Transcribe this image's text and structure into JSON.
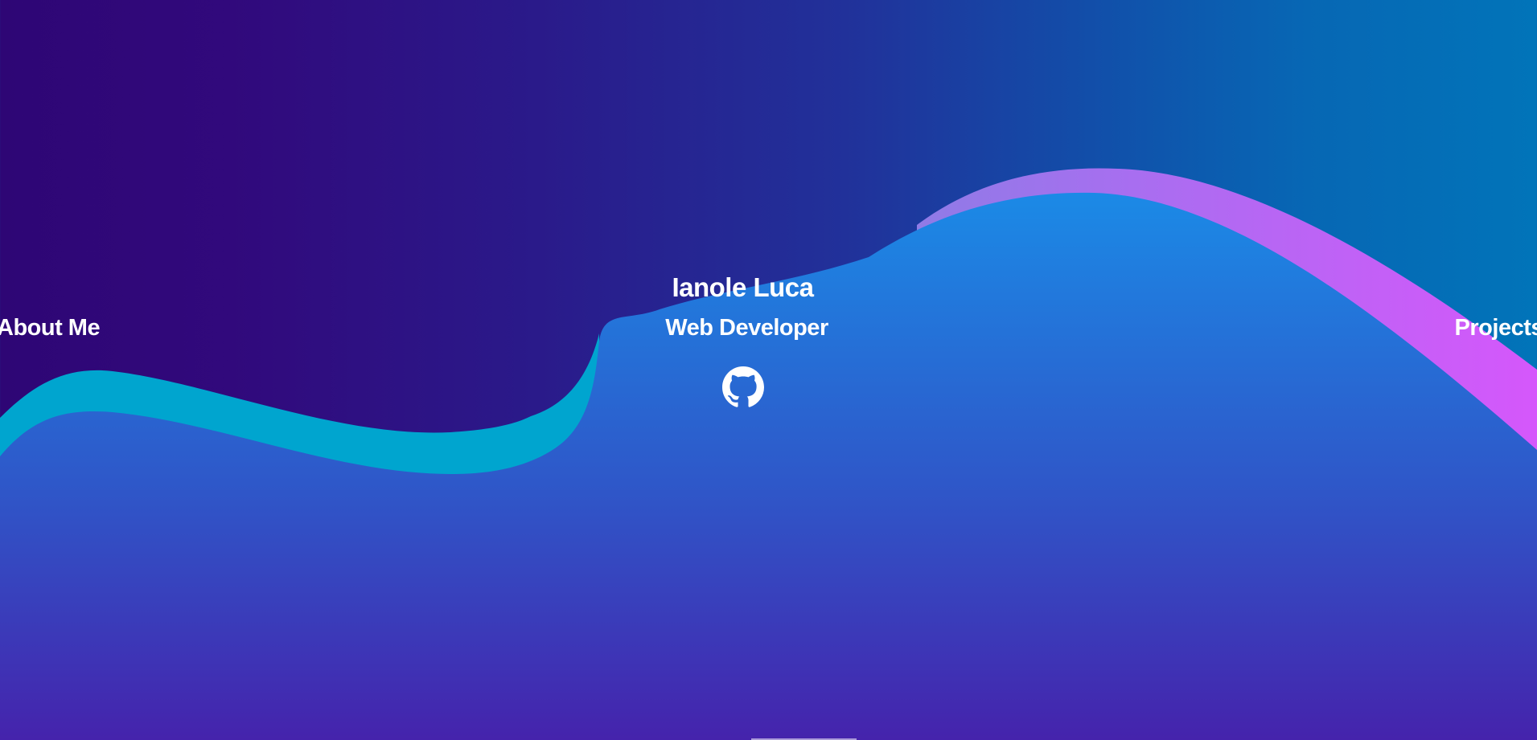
{
  "nav": {
    "left_label": "About Me",
    "right_label": "Projects"
  },
  "hero": {
    "name": "Ianole Luca",
    "role": "Web Developer",
    "social_icon": "github-icon"
  },
  "colors": {
    "background_left": "#2e0675",
    "background_right": "#0174b9",
    "wave_cyan": "#00a5cf",
    "wave_magenta": "#d557fb",
    "wave_front_top": "#1b8ae6",
    "wave_front_bottom": "#4523ac",
    "text": "#ffffff"
  }
}
